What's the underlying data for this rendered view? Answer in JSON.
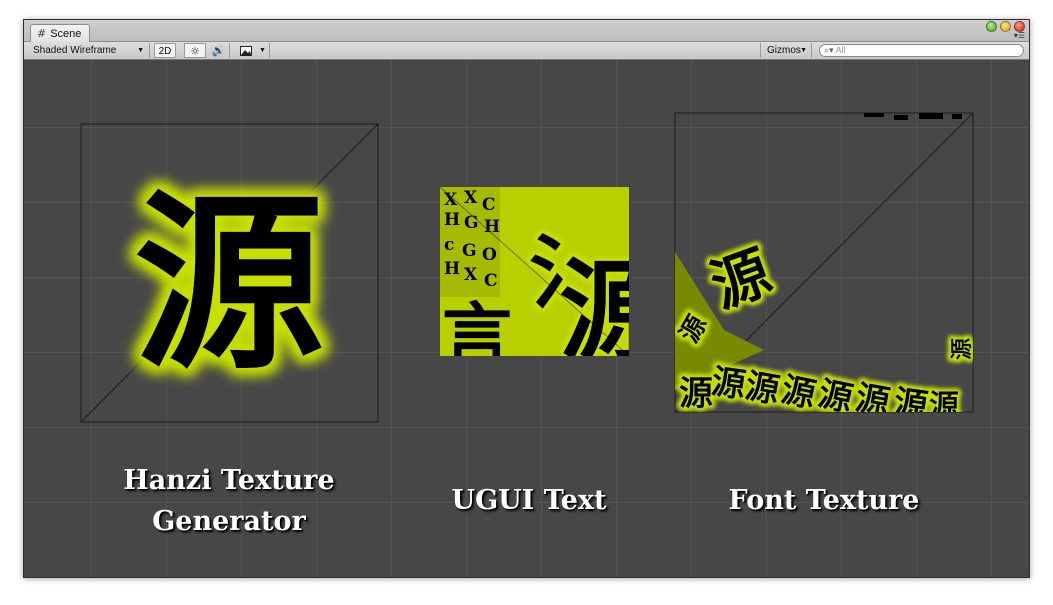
{
  "window": {
    "tab_label": "Scene",
    "tab_icon": "grid-icon",
    "window_controls": [
      "zoom-button",
      "minimize-button",
      "close-button"
    ]
  },
  "toolbar": {
    "draw_mode": "Shaded Wireframe",
    "mode_2d": "2D",
    "lighting_icon": "sun-icon",
    "audio_icon": "speaker-icon",
    "effects_icon": "image-icon",
    "gizmos": "Gizmos",
    "search_placeholder": "All"
  },
  "scene": {
    "sprites": [
      {
        "name": "hanzi-texture-sprite",
        "glyph": "源"
      },
      {
        "name": "ugui-text-sprite",
        "glyph": "源"
      },
      {
        "name": "font-texture-sprite",
        "glyph": "源"
      }
    ],
    "labels": {
      "hanzi_line1": "Hanzi Texture",
      "hanzi_line2": "Generator",
      "ugui": "UGUI Text",
      "font": "Font Texture"
    },
    "colors": {
      "viewport": "#474747",
      "glow": "#c8e000",
      "glyph": "#000000"
    }
  }
}
